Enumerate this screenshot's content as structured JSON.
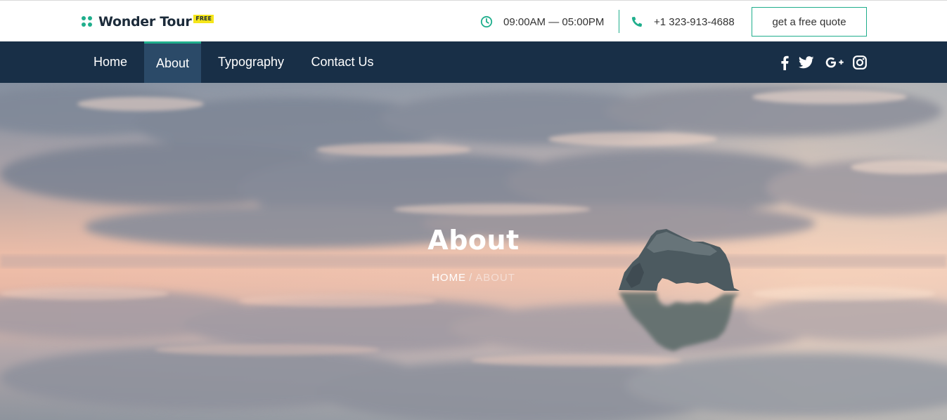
{
  "brand": {
    "name": "Wonder Tour",
    "badge": "FREE",
    "accent": "#1fae8c",
    "badge_color": "#f5e61a"
  },
  "topbar": {
    "hours": "09:00AM — 05:00PM",
    "phone": "+1 323-913-4688",
    "quote_label": "get a free quote",
    "hours_icon": "clock-icon",
    "phone_icon": "phone-icon"
  },
  "nav": {
    "items": [
      {
        "label": "Home",
        "active": false
      },
      {
        "label": "About",
        "active": true
      },
      {
        "label": "Typography",
        "active": false
      },
      {
        "label": "Contact Us",
        "active": false
      }
    ],
    "background": "#182f47",
    "active_background": "#2b4a68"
  },
  "social": [
    "facebook-icon",
    "twitter-icon",
    "google-plus-icon",
    "instagram-icon"
  ],
  "hero": {
    "title": "About",
    "breadcrumb": {
      "home": "HOME",
      "separator": "/",
      "current": "ABOUT"
    },
    "background_description_icon": "sky-reflection-rock-image"
  }
}
